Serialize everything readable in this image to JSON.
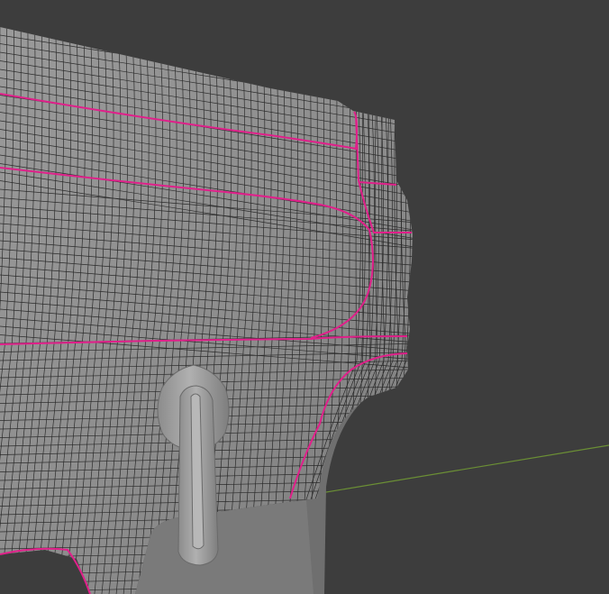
{
  "viewport": {
    "background_color": "#3d3d3d",
    "mesh_color": "#8e8e8e",
    "mesh_dark_color": "#7a7a7a",
    "wire_color": "#1a1a1a",
    "seam_color": "#e0208a",
    "axis_color": "#6b8f35",
    "knob_color": "#a2a2a2"
  },
  "scene": {
    "editor": "3d-viewport",
    "display_mode": "solid-with-wireframe",
    "object_type": "mesh",
    "seam_edges_shown": true,
    "x_axis_line_visible": true
  }
}
